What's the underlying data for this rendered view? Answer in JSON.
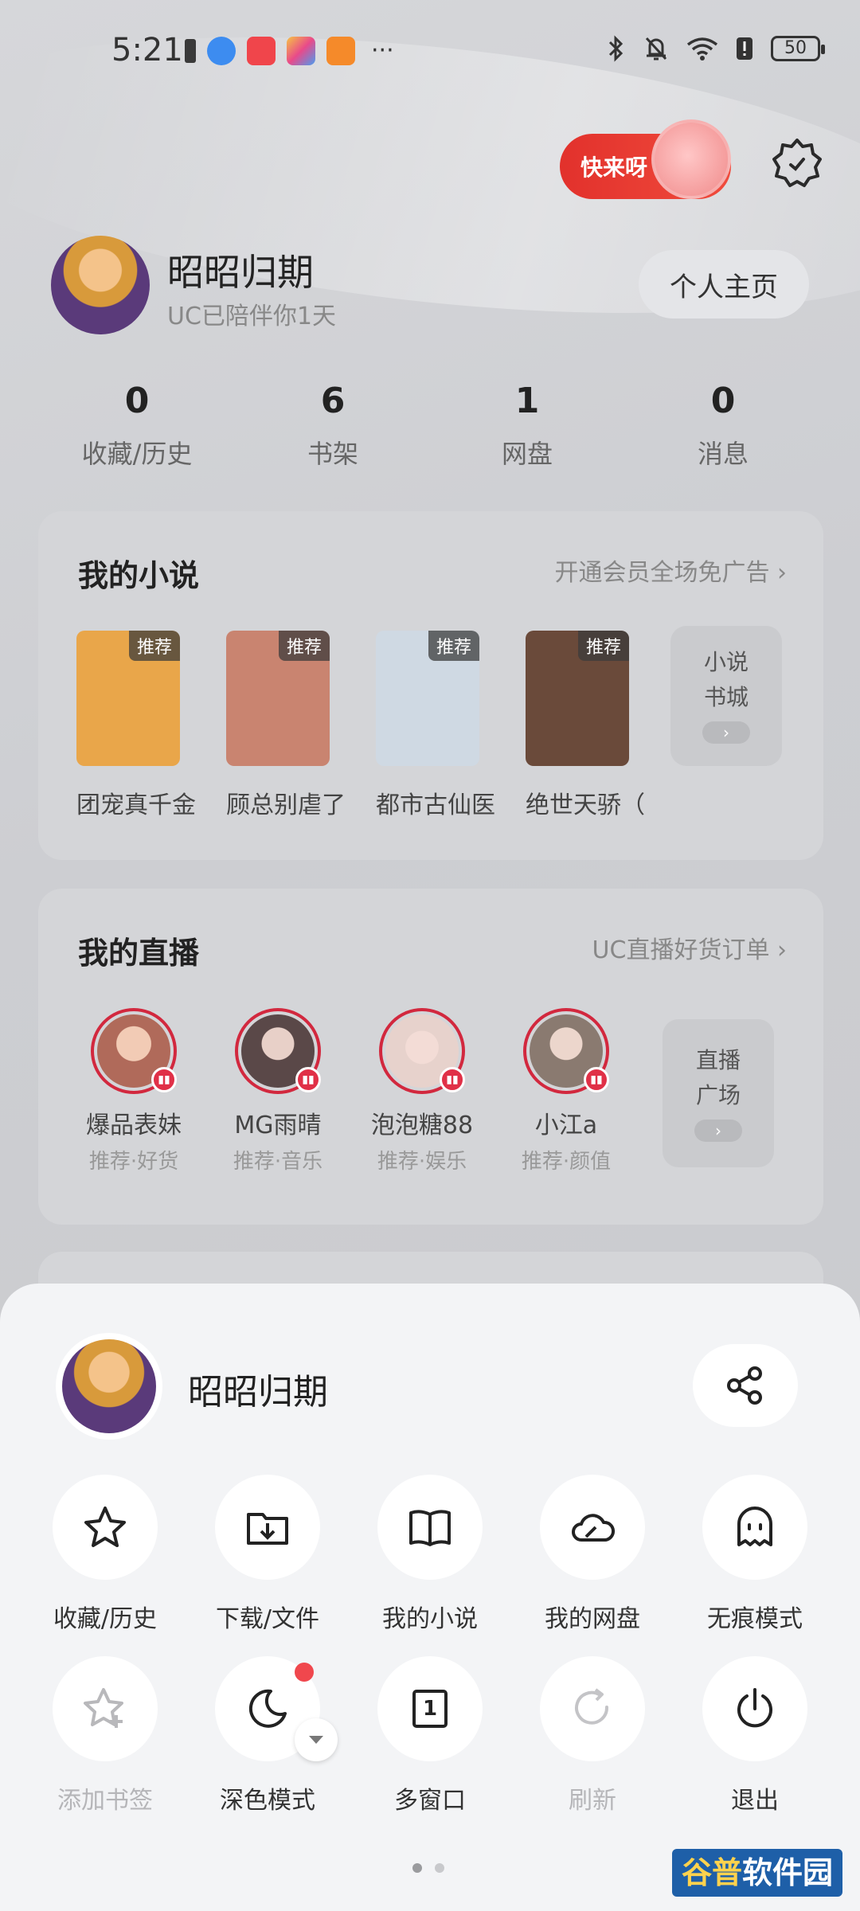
{
  "status_bar": {
    "time": "5:21",
    "battery": "50",
    "more_indicator": "···"
  },
  "header": {
    "promo_label": "快来呀",
    "settings_icon": "gear-icon"
  },
  "profile": {
    "name": "昭昭归期",
    "subtitle": "UC已陪伴你1天",
    "homepage_button": "个人主页"
  },
  "stats": [
    {
      "value": "0",
      "label": "收藏/历史"
    },
    {
      "value": "6",
      "label": "书架"
    },
    {
      "value": "1",
      "label": "网盘"
    },
    {
      "value": "0",
      "label": "消息"
    }
  ],
  "novels": {
    "title": "我的小说",
    "link": "开通会员全场免广告",
    "tag": "推荐",
    "books": [
      {
        "title": "团宠真千金",
        "color": "#e9a64a"
      },
      {
        "title": "顾总别虐了",
        "color": "#c98470"
      },
      {
        "title": "都市古仙医",
        "color": "#cfd9e3"
      },
      {
        "title": "绝世天骄（",
        "color": "#6a4a3a"
      }
    ],
    "more": {
      "line1": "小说",
      "line2": "书城"
    }
  },
  "live": {
    "title": "我的直播",
    "link": "UC直播好货订单",
    "streamers": [
      {
        "name": "爆品表妹",
        "sub": "推荐·好货",
        "color": "#b06a5a"
      },
      {
        "name": "MG雨晴",
        "sub": "推荐·音乐",
        "color": "#5a4848"
      },
      {
        "name": "泡泡糖88",
        "sub": "推荐·娱乐",
        "color": "#e7d2cc"
      },
      {
        "name": "小江a",
        "sub": "推荐·颜值",
        "color": "#8a7a70"
      }
    ],
    "more": {
      "line1": "直播",
      "line2": "广场"
    }
  },
  "sheet": {
    "name": "昭昭归期",
    "share_icon": "share-icon",
    "row1": [
      {
        "label": "收藏/历史",
        "icon": "star-icon"
      },
      {
        "label": "下载/文件",
        "icon": "download-folder-icon"
      },
      {
        "label": "我的小说",
        "icon": "book-icon"
      },
      {
        "label": "我的网盘",
        "icon": "cloud-icon"
      },
      {
        "label": "无痕模式",
        "icon": "ghost-icon"
      }
    ],
    "row2": [
      {
        "label": "添加书签",
        "icon": "add-bookmark-icon"
      },
      {
        "label": "深色模式",
        "icon": "moon-icon"
      },
      {
        "label": "多窗口",
        "icon": "window-icon",
        "count": "1"
      },
      {
        "label": "刷新",
        "icon": "refresh-icon"
      },
      {
        "label": "退出",
        "icon": "power-icon"
      }
    ]
  },
  "watermark": {
    "part1": "谷普",
    "part2": "软件园"
  }
}
